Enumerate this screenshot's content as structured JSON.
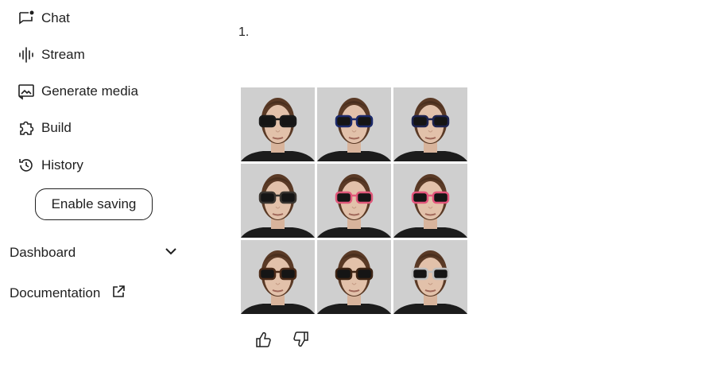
{
  "sidebar": {
    "items": [
      {
        "label": "Chat",
        "icon": "chat-icon"
      },
      {
        "label": "Stream",
        "icon": "waveform-icon"
      },
      {
        "label": "Generate media",
        "icon": "image-icon"
      },
      {
        "label": "Build",
        "icon": "puzzle-icon"
      },
      {
        "label": "History",
        "icon": "history-icon"
      }
    ],
    "enable_saving_label": "Enable saving",
    "dashboard_label": "Dashboard",
    "documentation_label": "Documentation"
  },
  "main": {
    "list_number": "1.",
    "image_grid": {
      "alt": "Grid of 9 sunglasses variations",
      "frame_colors": [
        "#1a1a1a",
        "#1c2a6b",
        "#1e2450",
        "#3a3530",
        "#e0587a",
        "#e4557c",
        "#4a2a18",
        "#3d2414",
        "#bfbfbf"
      ]
    }
  },
  "colors": {
    "text": "#1f1f1f",
    "background": "#ffffff"
  }
}
